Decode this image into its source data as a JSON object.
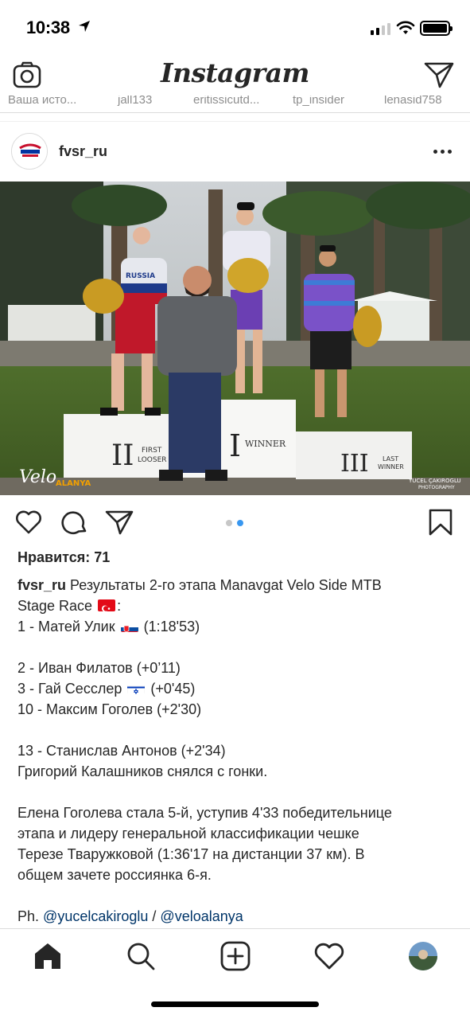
{
  "status_bar": {
    "time": "10:38",
    "icons": [
      "location-arrow-icon",
      "cellular-signal-icon",
      "wifi-icon",
      "battery-icon"
    ]
  },
  "header": {
    "logo": "Instagram",
    "left_icon": "camera-icon",
    "right_icon": "direct-message-icon"
  },
  "stories": [
    "Ваша исто...",
    "jall133",
    "eritissicutd...",
    "tp_insider",
    "lenasid758"
  ],
  "post": {
    "username": "fvsr_ru",
    "avatar_icon": "fvsr-logo-avatar",
    "photo_alt_texts": [
      "II",
      "FIRST LOOSER",
      "I",
      "WINNER",
      "III",
      "LAST WINNER",
      "VELO",
      "ALANYA",
      "YUCEL ÇAKIROGLU",
      "PHOTOGRAPHY",
      "RUSSIA"
    ],
    "carousel": {
      "count": 2,
      "active_index": 1
    },
    "likes_label": "Нравится: 71",
    "caption": {
      "intro": "Результаты 2-го этапа Manavgat Velo Side MTB",
      "intro_cont": "Stage Race",
      "results": [
        {
          "text": "1 - Матей Улик",
          "time": "(1:18'53)",
          "flag": "slovakia"
        },
        {
          "text": "2 - Иван Филатов (+0’11)"
        },
        {
          "text": "3 - Гай Сесслер",
          "time": "(+0'45)",
          "flag": "israel"
        },
        {
          "text": "10 - Максим Гоголев (+2'30)"
        },
        {
          "text": "13 - Станислав Антонов (+2'34)"
        },
        {
          "text": "Григорий Калашников снялся с гонки."
        }
      ],
      "women": [
        "Елена Гоголева стала 5-й, уступив 4'33 победительнице",
        "этапа и лидеру генеральной классификации чешке",
        "Терезе Тваружковой (1:36'17 на дистанции 37 км). В",
        "общем зачете россиянка 6-я."
      ],
      "credit_prefix": "Ph.",
      "credit_mention_1": "@yucelcakiroglu",
      "credit_sep": "/",
      "credit_mention_2": "@veloalanya"
    }
  },
  "actions": [
    "heart-icon",
    "comment-icon",
    "share-icon",
    "bookmark-icon"
  ],
  "tab_bar": [
    "home-icon",
    "search-icon",
    "new-post-icon",
    "activity-heart-icon",
    "profile-avatar"
  ],
  "colors": {
    "text": "#262626",
    "mention": "#003569",
    "secondary": "#8e8e8e",
    "carousel_active": "#3897f0"
  }
}
